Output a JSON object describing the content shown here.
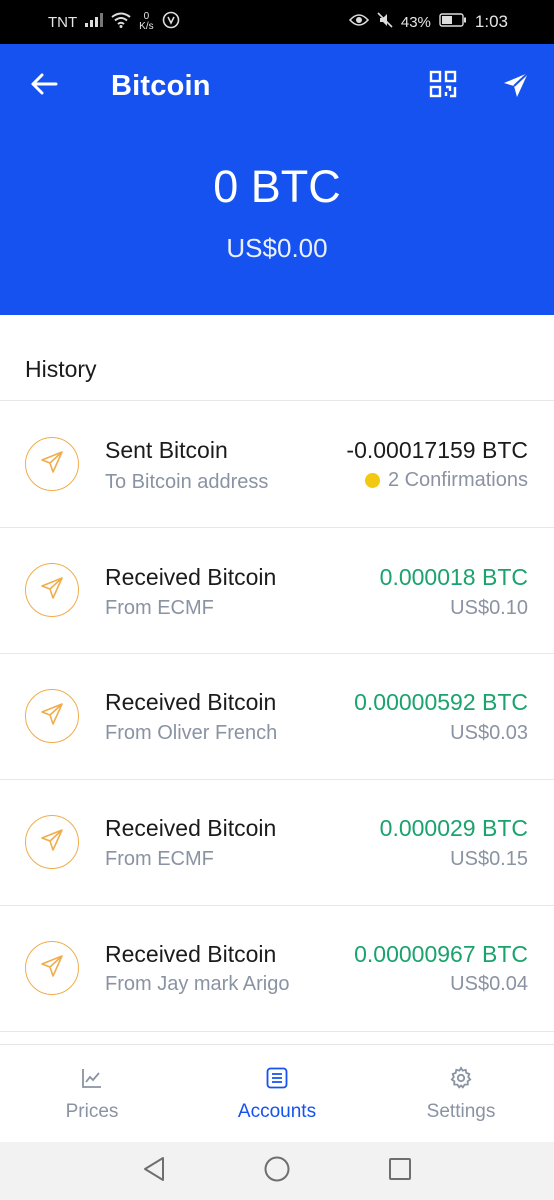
{
  "status_bar": {
    "carrier": "TNT",
    "speed_value": "0",
    "speed_unit": "K/s",
    "battery": "43%",
    "time": "1:03"
  },
  "header": {
    "title": "Bitcoin",
    "balance": "0 BTC",
    "balance_fiat": "US$0.00",
    "icons": {
      "back": "arrow-left-icon",
      "qr": "qr-code-icon",
      "send": "send-icon"
    }
  },
  "history": {
    "title": "History",
    "items": [
      {
        "title": "Sent Bitcoin",
        "subtitle": "To Bitcoin address",
        "amount": "-0.00017159 BTC",
        "meta": "2 Confirmations",
        "direction": "sent"
      },
      {
        "title": "Received Bitcoin",
        "subtitle": "From ECMF",
        "amount": "0.000018 BTC",
        "meta": "US$0.10",
        "direction": "received"
      },
      {
        "title": "Received Bitcoin",
        "subtitle": "From Oliver French",
        "amount": "0.00000592 BTC",
        "meta": "US$0.03",
        "direction": "received"
      },
      {
        "title": "Received Bitcoin",
        "subtitle": "From ECMF",
        "amount": "0.000029 BTC",
        "meta": "US$0.15",
        "direction": "received"
      },
      {
        "title": "Received Bitcoin",
        "subtitle": "From Jay mark Arigo",
        "amount": "0.00000967 BTC",
        "meta": "US$0.04",
        "direction": "received"
      }
    ]
  },
  "bottom_nav": {
    "items": [
      {
        "label": "Prices",
        "icon": "chart-icon",
        "active": false
      },
      {
        "label": "Accounts",
        "icon": "list-icon",
        "active": true
      },
      {
        "label": "Settings",
        "icon": "gear-icon",
        "active": false
      }
    ]
  },
  "colors": {
    "brand": "#1652f0",
    "positive": "#1aa36c",
    "pending": "#f2c811",
    "icon_ring": "#f0ad4e"
  }
}
